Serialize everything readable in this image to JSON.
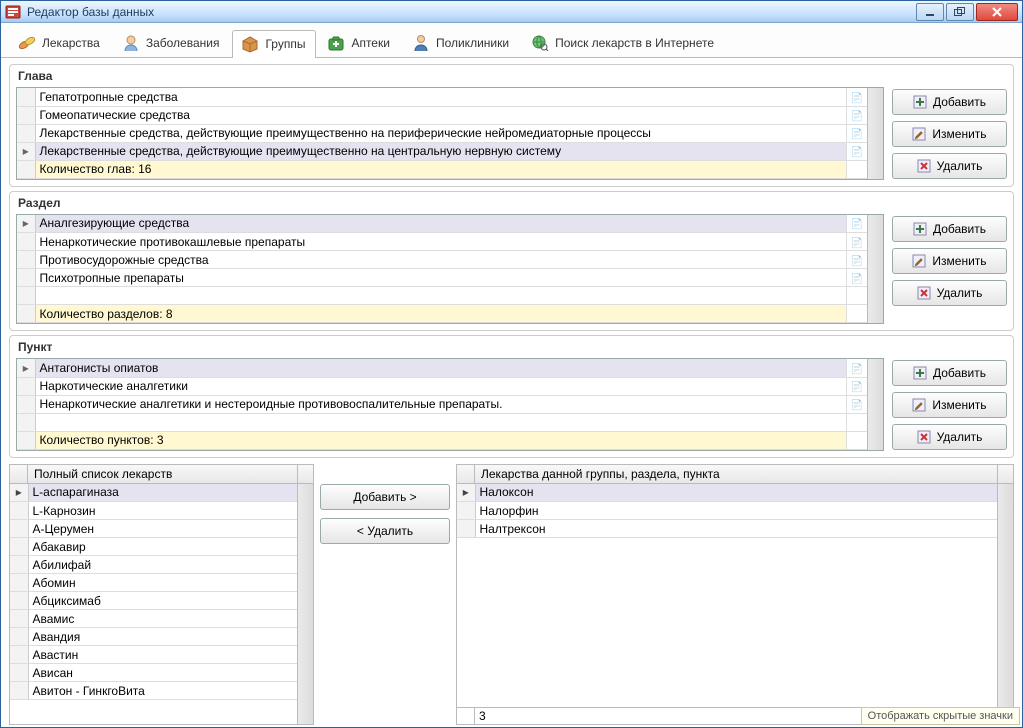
{
  "window": {
    "title": "Редактор базы данных"
  },
  "tabs": [
    {
      "label": "Лекарства"
    },
    {
      "label": "Заболевания"
    },
    {
      "label": "Группы"
    },
    {
      "label": "Аптеки"
    },
    {
      "label": "Поликлиники"
    },
    {
      "label": "Поиск лекарств в Интернете"
    }
  ],
  "buttons": {
    "add": "Добавить",
    "edit": "Изменить",
    "delete": "Удалить",
    "add_to": "Добавить >",
    "remove_from": "< Удалить"
  },
  "chapter": {
    "title": "Глава",
    "rows": [
      "Гепатотропные средства",
      "Гомеопатические средства",
      "Лекарственные средства, действующие преимущественно на периферические нейромедиаторные процессы",
      "Лекарственные средства, действующие преимущественно на центральную нервную систему"
    ],
    "selected_index": 3,
    "footer": "Количество глав: 16"
  },
  "section": {
    "title": "Раздел",
    "rows": [
      "Аналгезирующие средства",
      "Ненаркотические противокашлевые препараты",
      "Противосудорожные средства",
      "Психотропные препараты"
    ],
    "selected_index": 0,
    "footer": "Количество разделов: 8"
  },
  "item": {
    "title": "Пункт",
    "rows": [
      "Антагонисты опиатов",
      "Наркотические аналгетики",
      "Ненаркотические аналгетики и нестероидные противовоспалительные препараты."
    ],
    "selected_index": 0,
    "footer": "Количество пунктов: 3"
  },
  "full_list": {
    "header": "Полный список лекарств",
    "rows": [
      "L-аспарагиназа",
      "L-Карнозин",
      "А-Церумен",
      "Абакавир",
      "Абилифай",
      "Абомин",
      "Абциксимаб",
      "Авамис",
      "Авандия",
      "Авастин",
      "Ависан",
      "Авитон - ГинкгоВита"
    ],
    "selected_index": 0
  },
  "group_list": {
    "header": "Лекарства данной группы, раздела, пункта",
    "rows": [
      "Налоксон",
      "Налорфин",
      "Налтрексон"
    ],
    "selected_index": 0,
    "footer": "3"
  },
  "status_hint": "Отображать скрытые значки"
}
